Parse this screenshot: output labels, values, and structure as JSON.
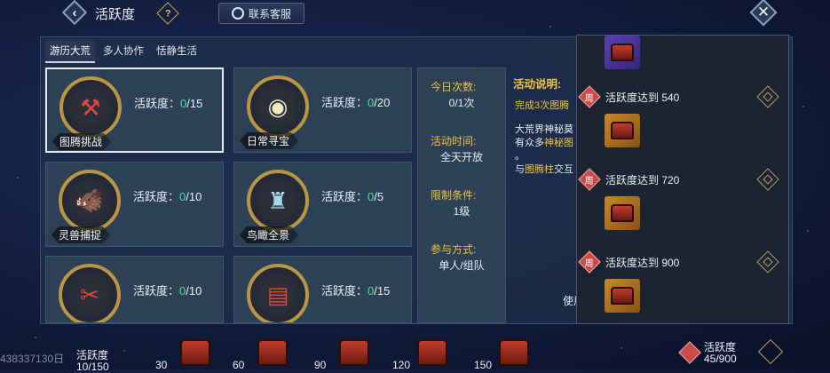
{
  "header": {
    "title": "活跃度",
    "help_glyph": "?",
    "service_label": "联系客服"
  },
  "tabs": [
    {
      "label": "游历大荒",
      "active": true
    },
    {
      "label": "多人协作",
      "active": false
    },
    {
      "label": "恬静生活",
      "active": false
    }
  ],
  "activities": [
    {
      "name": "图腾挑战",
      "score_label": "活跃度：",
      "current": "0",
      "max": "/15",
      "icon": "totem-axe-icon",
      "selected": true
    },
    {
      "name": "日常寻宝",
      "score_label": "活跃度：",
      "current": "0",
      "max": "/20",
      "icon": "coin-icon",
      "selected": false
    },
    {
      "name": "灵兽捕捉",
      "score_label": "活跃度：",
      "current": "0",
      "max": "/10",
      "icon": "beast-icon",
      "selected": false
    },
    {
      "name": "鸟瞰全景",
      "score_label": "活跃度：",
      "current": "0",
      "max": "/5",
      "icon": "tower-icon",
      "selected": false
    },
    {
      "name": "",
      "score_label": "活跃度：",
      "current": "0",
      "max": "/10",
      "icon": "crossed-tools-icon",
      "selected": false
    },
    {
      "name": "",
      "score_label": "活跃度：",
      "current": "0",
      "max": "/15",
      "icon": "calendar-icon",
      "selected": false
    }
  ],
  "info": {
    "today_label": "今日次数:",
    "today_value": "0/1次",
    "time_label": "活动时间:",
    "time_value": "全天开放",
    "limit_label": "限制条件:",
    "limit_value": "1级",
    "mode_label": "参与方式:",
    "mode_value": "单人/组队"
  },
  "description": {
    "title": "活动说明:",
    "line1_prefix": "完成3次图腾",
    "line2": "大荒界神秘莫",
    "line3_prefix": "有众多",
    "line3_highlight": "神秘图",
    "line4": "。",
    "line5_prefix": "与",
    "line5_highlight": "图腾柱",
    "line5_suffix": "交互",
    "use_text": "使用"
  },
  "rewards_popup": {
    "week_glyph": "周",
    "tiers": [
      {
        "requirement": "活跃度达到 540"
      },
      {
        "requirement": "活跃度达到 720"
      },
      {
        "requirement": "活跃度达到 900"
      }
    ]
  },
  "bottom": {
    "uid": "438337130日",
    "progress_label": "活跃度",
    "progress_value": "10/150",
    "progress_fraction": 0.0667,
    "milestones": [
      "30",
      "60",
      "90",
      "120",
      "150"
    ],
    "weekly_label": "活跃度",
    "weekly_value": "45/900"
  },
  "colors": {
    "accent_gold": "#f0c340",
    "score_green": "#52e08e",
    "week_red": "#c94a4a"
  }
}
